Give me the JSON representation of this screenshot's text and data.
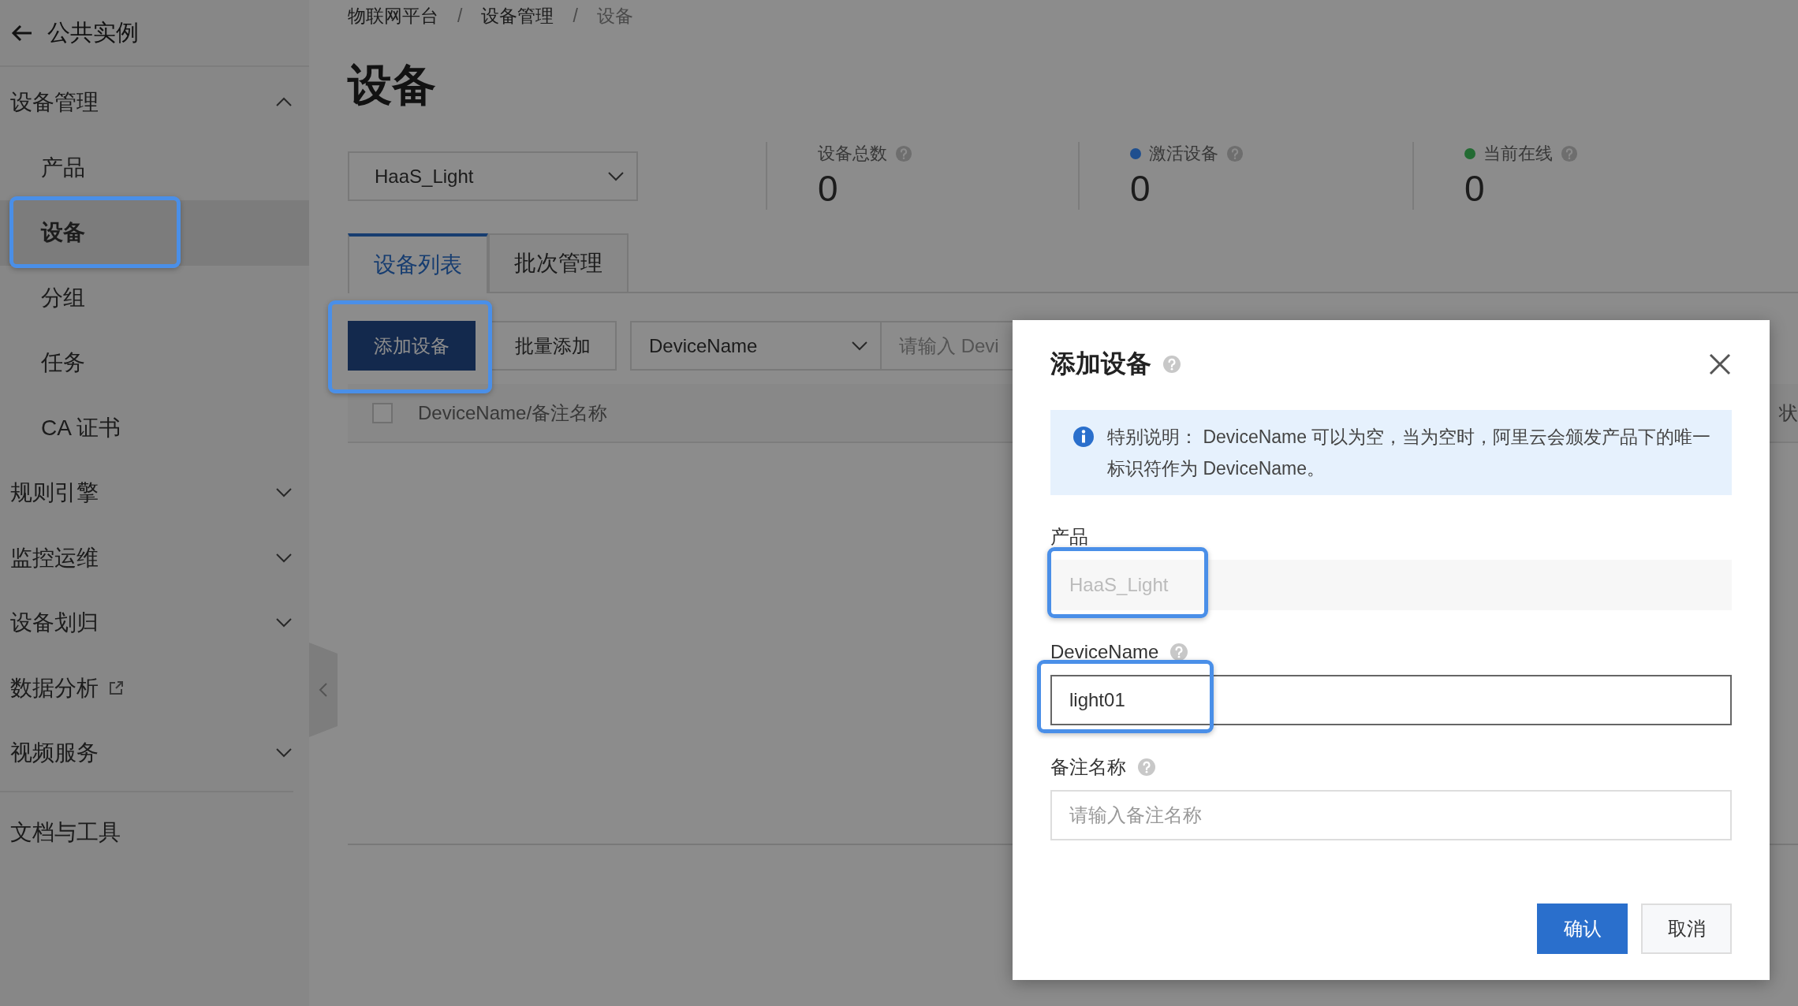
{
  "sidebar": {
    "back_title": "公共实例",
    "menu": [
      {
        "label": "设备管理",
        "kind": "group",
        "expanded": true,
        "children": [
          {
            "label": "产品",
            "selected": false,
            "highlighted": false
          },
          {
            "label": "设备",
            "selected": true,
            "highlighted": true
          },
          {
            "label": "分组",
            "selected": false,
            "highlighted": false
          },
          {
            "label": "任务",
            "selected": false,
            "highlighted": false
          },
          {
            "label": "CA 证书",
            "selected": false,
            "highlighted": false
          }
        ]
      },
      {
        "label": "规则引擎",
        "kind": "group",
        "expanded": false
      },
      {
        "label": "监控运维",
        "kind": "group",
        "expanded": false
      },
      {
        "label": "设备划归",
        "kind": "group",
        "expanded": false
      },
      {
        "label": "数据分析",
        "kind": "external"
      },
      {
        "label": "视频服务",
        "kind": "group",
        "expanded": false
      }
    ],
    "footer_item": "文档与工具"
  },
  "breadcrumb": [
    {
      "text": "物联网平台",
      "kind": "link"
    },
    {
      "text": "/",
      "kind": "separator"
    },
    {
      "text": "设备管理",
      "kind": "link"
    },
    {
      "text": "/",
      "kind": "separator"
    },
    {
      "text": "设备",
      "kind": "current"
    }
  ],
  "page_title": "设备",
  "product_select": {
    "value": "HaaS_Light"
  },
  "stats": [
    {
      "label": "设备总数",
      "value": "0"
    },
    {
      "label": "激活设备",
      "value": "0",
      "color": "#1f4f8f"
    },
    {
      "label": "当前在线",
      "value": "0",
      "color": "#236b33"
    }
  ],
  "tabs": [
    {
      "label": "设备列表",
      "selected": true
    },
    {
      "label": "批次管理",
      "selected": false
    }
  ],
  "toolbar": {
    "buttons": [
      {
        "label": "添加设备",
        "kind": "primary",
        "highlighted": true
      },
      {
        "label": "批量添加",
        "kind": "secondary",
        "highlighted": false
      }
    ],
    "filter_select": "DeviceName",
    "search_placeholder": "请输入 Devi"
  },
  "table": {
    "select_all_checked": false,
    "columns": [
      {
        "label": "DeviceName/备注名称"
      },
      {
        "label": "状"
      }
    ]
  },
  "dialog": {
    "title": "添加设备",
    "info_text": "特别说明： DeviceName 可以为空，当为空时，阿里云会颁发产品下的唯一标识符作为 DeviceName。",
    "fields": [
      {
        "label": "产品",
        "value": "HaaS_Light",
        "disabled": true,
        "help": false,
        "highlighted": true
      },
      {
        "label": "DeviceName",
        "value": "light01",
        "disabled": false,
        "help": true,
        "highlighted": true
      },
      {
        "label": "备注名称",
        "placeholder": "请输入备注名称",
        "disabled": false,
        "help": true,
        "highlighted": false
      }
    ],
    "buttons": [
      {
        "label": "确认",
        "kind": "primary"
      },
      {
        "label": "取消",
        "kind": "secondary"
      }
    ]
  }
}
